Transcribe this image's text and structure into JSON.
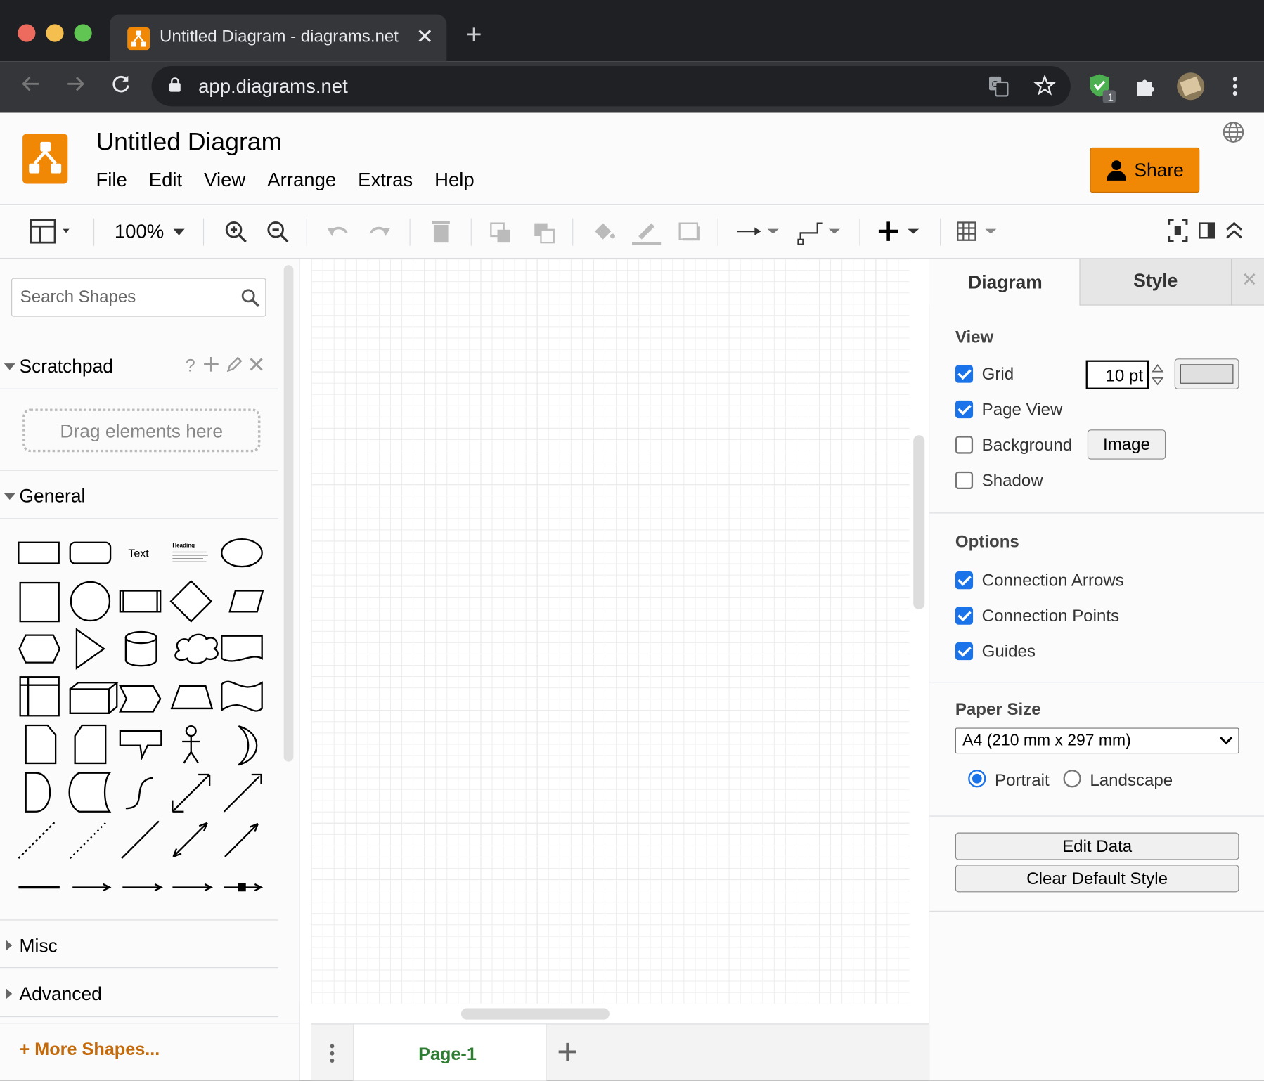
{
  "browser": {
    "tab_title": "Untitled Diagram - diagrams.net",
    "url": "app.diagrams.net",
    "extension_badge": "1"
  },
  "app": {
    "title": "Untitled Diagram",
    "menu": [
      "File",
      "Edit",
      "View",
      "Arrange",
      "Extras",
      "Help"
    ],
    "share_label": "Share",
    "accent_color": "#f08705"
  },
  "toolbar": {
    "zoom": "100%"
  },
  "sidebar": {
    "search_placeholder": "Search Shapes",
    "scratchpad_label": "Scratchpad",
    "scratchpad_help": "?",
    "drag_hint": "Drag elements here",
    "general_label": "General",
    "text_shape_label": "Text",
    "heading_shape_label": "Heading",
    "misc_label": "Misc",
    "advanced_label": "Advanced",
    "more_shapes_label": "+ More Shapes..."
  },
  "pages": {
    "current": "Page-1"
  },
  "format_panel": {
    "tabs": [
      "Diagram",
      "Style"
    ],
    "view_title": "View",
    "grid_label": "Grid",
    "grid_checked": true,
    "grid_size": "10 pt",
    "page_view_label": "Page View",
    "page_view_checked": true,
    "background_label": "Background",
    "background_checked": false,
    "image_button": "Image",
    "shadow_label": "Shadow",
    "shadow_checked": false,
    "options_title": "Options",
    "connection_arrows_label": "Connection Arrows",
    "connection_points_label": "Connection Points",
    "guides_label": "Guides",
    "paper_size_title": "Paper Size",
    "paper_size_value": "A4 (210 mm x 297 mm)",
    "portrait_label": "Portrait",
    "landscape_label": "Landscape",
    "orientation": "Portrait",
    "edit_data_button": "Edit Data",
    "clear_default_style_button": "Clear Default Style"
  }
}
